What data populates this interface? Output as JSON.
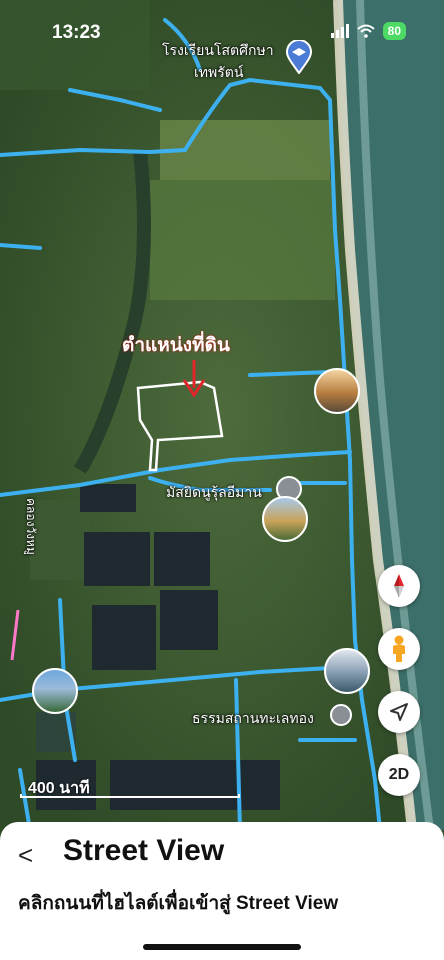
{
  "status": {
    "time": "13:23",
    "battery": "80"
  },
  "map_labels": {
    "school": "โรงเรียนโสตศึกษา",
    "school_line2": "เทพรัตน์",
    "land_position": "ตำแหน่งที่ดิน",
    "mosque": "มัสยิดนูรุ้ลอีมาน",
    "canal": "คลองวังหมู",
    "retreat": "ธรรมสถานทะเลทอง"
  },
  "controls": {
    "view_2d": "2D"
  },
  "scale": {
    "label": "400 นาที"
  },
  "sheet": {
    "back": "<",
    "title": "Street View",
    "description": "คลิกถนนที่ไฮไลต์เพื่อเข้าสู่ Street View"
  },
  "colors": {
    "road": "#3db1f0",
    "parcel": "#ffffff",
    "accent_arrow": "#e2262b",
    "sea": "#3b6f6a"
  },
  "icons": [
    "back-chevron-icon",
    "compass-icon",
    "pegman-icon",
    "location-arrow-icon",
    "school-pin-icon",
    "mosque-pin-icon",
    "retreat-pin-icon"
  ]
}
